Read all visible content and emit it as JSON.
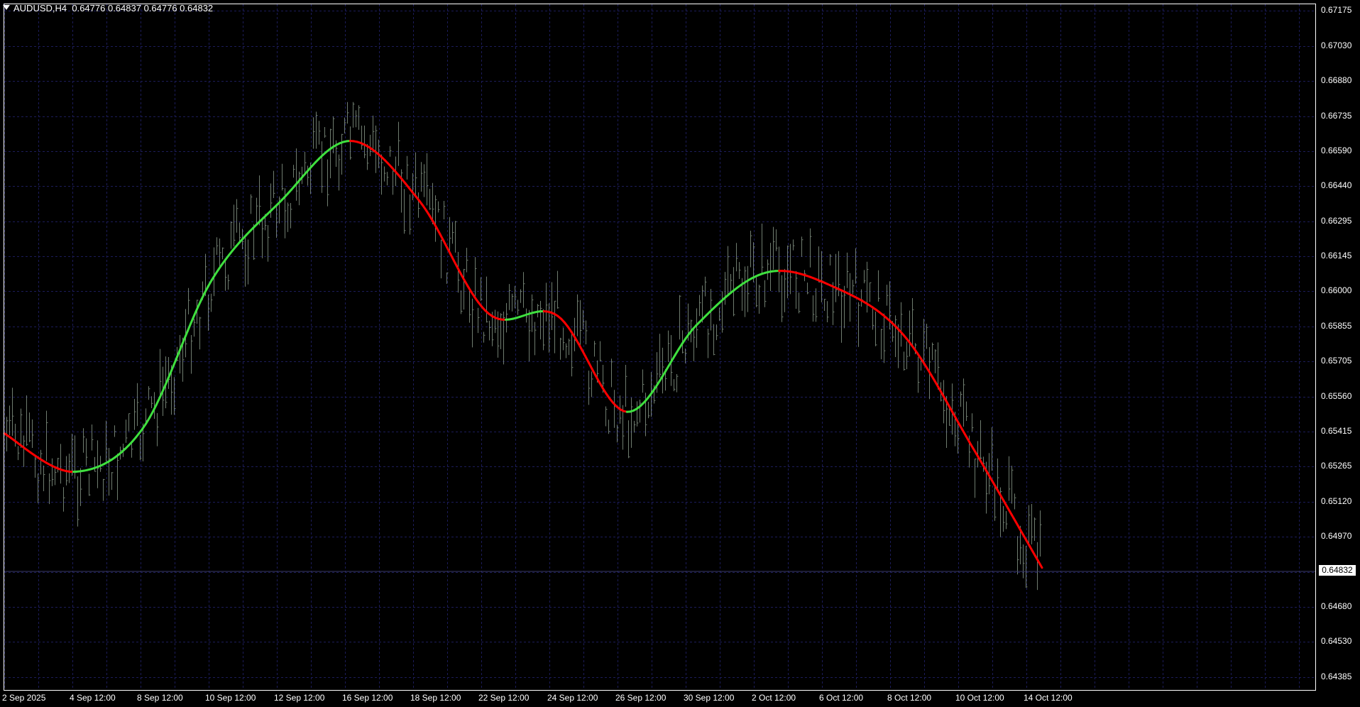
{
  "header": {
    "symbol_timeframe": "AUDUSD,H4",
    "ohlc": "0.64776 0.64837 0.64776 0.64832"
  },
  "current_price": "0.64832",
  "y_axis_labels": [
    "0.67175",
    "0.67030",
    "0.66880",
    "0.66735",
    "0.66590",
    "0.66440",
    "0.66295",
    "0.66145",
    "0.66000",
    "0.65855",
    "0.65705",
    "0.65560",
    "0.65415",
    "0.65265",
    "0.65120",
    "0.64970",
    "0.64680",
    "0.64530",
    "0.64385"
  ],
  "x_axis_labels": [
    "2 Sep 2025",
    "4 Sep 12:00",
    "8 Sep 12:00",
    "10 Sep 12:00",
    "12 Sep 12:00",
    "16 Sep 12:00",
    "18 Sep 12:00",
    "22 Sep 12:00",
    "24 Sep 12:00",
    "26 Sep 12:00",
    "30 Sep 12:00",
    "2 Oct 12:00",
    "6 Oct 12:00",
    "8 Oct 12:00",
    "10 Oct 12:00",
    "14 Oct 12:00"
  ],
  "colors": {
    "background": "#000000",
    "grid": "#1c1c5a",
    "bars": "#6f7c6f",
    "ma_up": "#3fe03f",
    "ma_down": "#ff0000",
    "axis_text": "#ffffff",
    "frame": "#ffffff"
  },
  "chart_data": {
    "type": "line",
    "symbol": "AUDUSD",
    "timeframe": "H4",
    "ylim": [
      0.6436,
      0.6722
    ],
    "grid": true,
    "bars": "OHLC (approximate)",
    "series": [
      {
        "name": "moving average",
        "color_by_direction": {
          "up": "#3fe03f",
          "down": "#ff0000"
        },
        "x": [
          "2 Sep 2025",
          "4 Sep 12:00",
          "8 Sep 12:00",
          "10 Sep 12:00",
          "12 Sep 12:00",
          "16 Sep 12:00",
          "18 Sep 12:00",
          "22 Sep 12:00",
          "24 Sep 12:00",
          "26 Sep 12:00",
          "30 Sep 12:00",
          "2 Oct 12:00",
          "6 Oct 12:00",
          "8 Oct 12:00",
          "10 Oct 12:00",
          "14 Oct 12:00"
        ],
        "values": [
          0.6543,
          0.6527,
          0.6545,
          0.6607,
          0.664,
          0.6665,
          0.664,
          0.6593,
          0.6592,
          0.6552,
          0.6588,
          0.661,
          0.6604,
          0.6584,
          0.6537,
          0.6487
        ]
      }
    ],
    "last_price": 0.64832
  }
}
